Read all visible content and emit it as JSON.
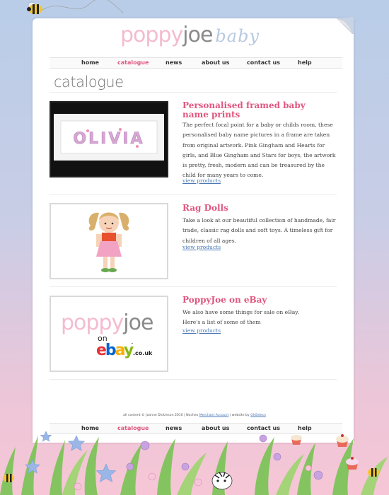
{
  "brand": {
    "part1": "poppy",
    "part2": "joe",
    "part3": "baby"
  },
  "nav": [
    "home",
    "catalogue",
    "news",
    "about us",
    "contact us",
    "help"
  ],
  "page_title": "catalogue",
  "products": [
    {
      "title": "Personalised framed baby name prints",
      "description": "The perfect focal point for a baby or childs room, these personalised baby name pictures in a frame are taken from original artwork. Pink Gingham and Hearts for girls, and Blue Gingham and Stars for boys, the artwork is pretty, fresh, modern and can be treasured by the child for many years to come.",
      "link": "view products",
      "image_text": "OLIVIA"
    },
    {
      "title": "Rag Dolls",
      "description": "Take a look at our beautiful collection of handmade, fair trade, classic rag dolls and soft toys. A timeless gift for children of all ages.",
      "link": "view products"
    },
    {
      "title": "PoppyJoe on eBay",
      "description": "We also have some things for sale on eBay. Here's a list of some of them",
      "link": "view products",
      "logo": {
        "part1": "poppy",
        "part2": "joe",
        "on": "on",
        "ebay": [
          "e",
          "b",
          "a",
          "y"
        ],
        "tld": ".co.uk",
        "tm": "™"
      }
    }
  ],
  "footer": {
    "prefix": "all content © Joanne Dickinson 2010 | Nochex",
    "merchant_link": "Merchant Account",
    "middle": "| website by",
    "credit_link": "Gh0ldesn"
  },
  "colors": {
    "accent_pink": "#e0577f",
    "logo_pink": "#f3bcd0",
    "link_blue": "#4a79b5",
    "ebay_colors": [
      "#e53238",
      "#0064d2",
      "#f5af02",
      "#86b817"
    ]
  }
}
